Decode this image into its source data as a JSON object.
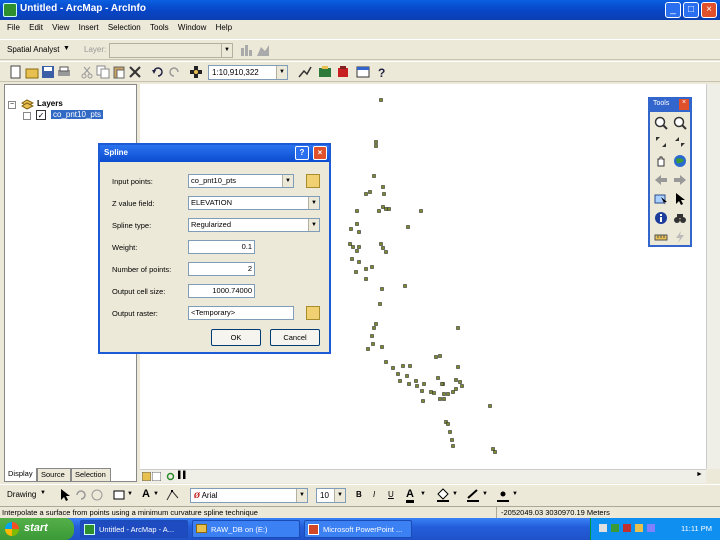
{
  "window": {
    "title": "Untitled - ArcMap - ArcInfo"
  },
  "menu": [
    "File",
    "Edit",
    "View",
    "Insert",
    "Selection",
    "Tools",
    "Window",
    "Help"
  ],
  "editor_toolbar": {
    "spatial_analyst_label": "Spatial Analyst",
    "layer_label": "Layer:"
  },
  "standard_toolbar": {
    "scale": "1:10,910,322"
  },
  "toc": {
    "root_label": "Layers",
    "layer_name": "co_pnt10_pts",
    "tabs": [
      "Display",
      "Source",
      "Selection"
    ]
  },
  "tools_toolbar": {
    "title": "Tools"
  },
  "dialog": {
    "title": "Spline",
    "input_points_label": "Input points:",
    "input_points_value": "co_pnt10_pts",
    "z_field_label": "Z value field:",
    "z_field_value": "ELEVATION",
    "spline_type_label": "Spline type:",
    "spline_type_value": "Regularized",
    "weight_label": "Weight:",
    "weight_value": "0.1",
    "number_points_label": "Number of points:",
    "number_points_value": "2",
    "cell_size_label": "Output cell size:",
    "cell_size_value": "1000.74000",
    "output_raster_label": "Output raster:",
    "output_raster_value": "<Temporary>",
    "ok_label": "OK",
    "cancel_label": "Cancel"
  },
  "drawing_toolbar": {
    "drawing_label": "Drawing",
    "font_name": "Arial",
    "font_size": "10",
    "bold": "B",
    "italic": "I",
    "underline": "U"
  },
  "status": {
    "message": "Interpolate a surface from points using a minimum curvature spline technique",
    "coords": "-2052049.03  3030970.19 Meters"
  },
  "taskbar": {
    "start_label": "start",
    "items": [
      "Untitled - ArcMap - A...",
      "RAW_DB on (E:)",
      "Microsoft PowerPoint ..."
    ],
    "clock": "11:11 PM"
  }
}
